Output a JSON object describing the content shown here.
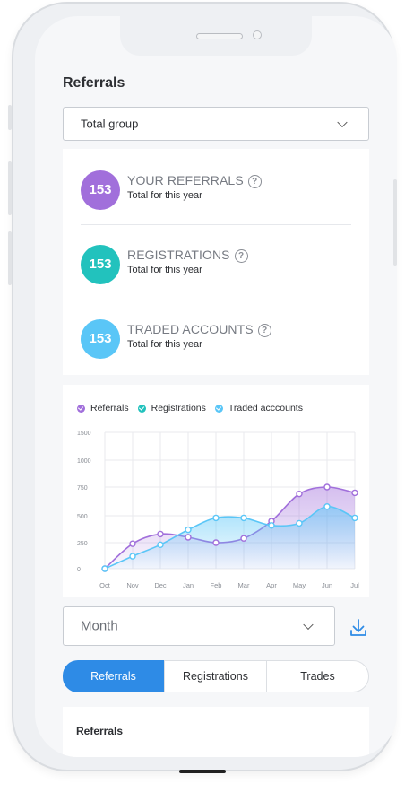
{
  "page": {
    "title": "Referrals"
  },
  "group_select": {
    "value": "Total group"
  },
  "stats": [
    {
      "badge": "153",
      "title": "YOUR REFERRALS",
      "subtitle": "Total for this year",
      "color": "#a16fdb"
    },
    {
      "badge": "153",
      "title": "REGISTRATIONS",
      "subtitle": "Total for this year",
      "color": "#22c2bd"
    },
    {
      "badge": "153",
      "title": "TRADED ACCOUNTS",
      "subtitle": "Total for this year",
      "color": "#5ac6f7"
    }
  ],
  "help_glyph": "?",
  "chart_data": {
    "type": "area",
    "x": [
      "Oct",
      "Nov",
      "Dec",
      "Jan",
      "Feb",
      "Mar",
      "Apr",
      "May",
      "Jun",
      "Jul"
    ],
    "yticks": [
      "1500",
      "1000",
      "750",
      "500",
      "250",
      "0"
    ],
    "series": [
      {
        "name": "Referrals",
        "color": "#a16fdb",
        "values": [
          0,
          240,
          330,
          300,
          250,
          290,
          450,
          690,
          750,
          700
        ]
      },
      {
        "name": "Registrations",
        "color": "#22c2bd",
        "values": [
          0,
          120,
          230,
          370,
          480,
          480,
          410,
          430,
          580,
          480
        ]
      }
    ],
    "legend": [
      {
        "label": "Referrals",
        "color": "#a16fdb"
      },
      {
        "label": "Registrations",
        "color": "#22c2bd"
      },
      {
        "label": "Traded acccounts",
        "color": "#5ac6f7"
      }
    ],
    "grid": true,
    "legend_position": "top-left"
  },
  "period_select": {
    "value": "Month"
  },
  "download": {
    "icon": "download-icon",
    "color": "#2e8be6"
  },
  "tabs": [
    {
      "label": "Referrals",
      "active": true
    },
    {
      "label": "Registrations",
      "active": false
    },
    {
      "label": "Trades",
      "active": false
    }
  ],
  "bottom_card": {
    "title": "Referrals"
  },
  "colors": {
    "accent": "#2e8be6"
  }
}
